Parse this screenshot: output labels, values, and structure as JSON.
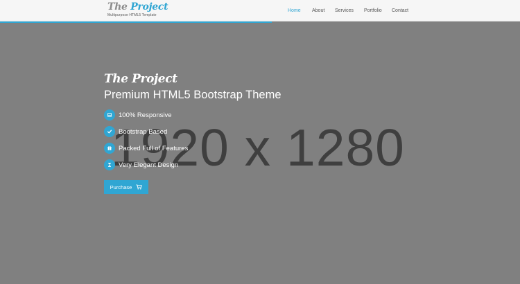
{
  "header": {
    "logo_prefix": "The ",
    "logo_brand": "Project",
    "tagline": "Multipurpose HTML5 Template",
    "nav": [
      {
        "label": "Home",
        "active": true
      },
      {
        "label": "About",
        "active": false
      },
      {
        "label": "Services",
        "active": false
      },
      {
        "label": "Portfolio",
        "active": false
      },
      {
        "label": "Contact",
        "active": false
      }
    ]
  },
  "placeholder": {
    "text": "1920 x 1280"
  },
  "hero": {
    "title": "The Project",
    "subtitle": "Premium HTML5 Bootstrap Theme",
    "features": [
      {
        "icon": "laptop-icon",
        "label": "100% Responsive"
      },
      {
        "icon": "check-icon",
        "label": "Bootstrap Based"
      },
      {
        "icon": "gift-icon",
        "label": "Packed Full of Features"
      },
      {
        "icon": "hourglass-icon",
        "label": "Very Elegant Design"
      }
    ],
    "button": {
      "label": "Purchase",
      "icon": "cart-icon"
    }
  },
  "colors": {
    "accent": "#30a6d3",
    "hero_bg": "#808080",
    "header_bg": "#f6f6f6",
    "placeholder_text": "#3f3f3f"
  }
}
